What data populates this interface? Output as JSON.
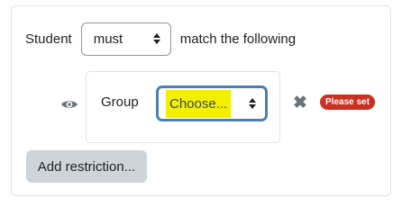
{
  "restriction": {
    "prefix": "Student",
    "match_select": {
      "value": "must"
    },
    "suffix": "match the following"
  },
  "condition": {
    "visibility_icon": "eye-icon",
    "type_label": "Group",
    "group_select": {
      "value": "Choose..."
    },
    "delete_icon": "close-icon",
    "badge": "Please set"
  },
  "add_button": "Add restriction...",
  "colors": {
    "select_focus_border": "#4d7fb0",
    "highlight": "#f3ef00",
    "badge_bg": "#ca3120",
    "button_bg": "#ced4da"
  }
}
